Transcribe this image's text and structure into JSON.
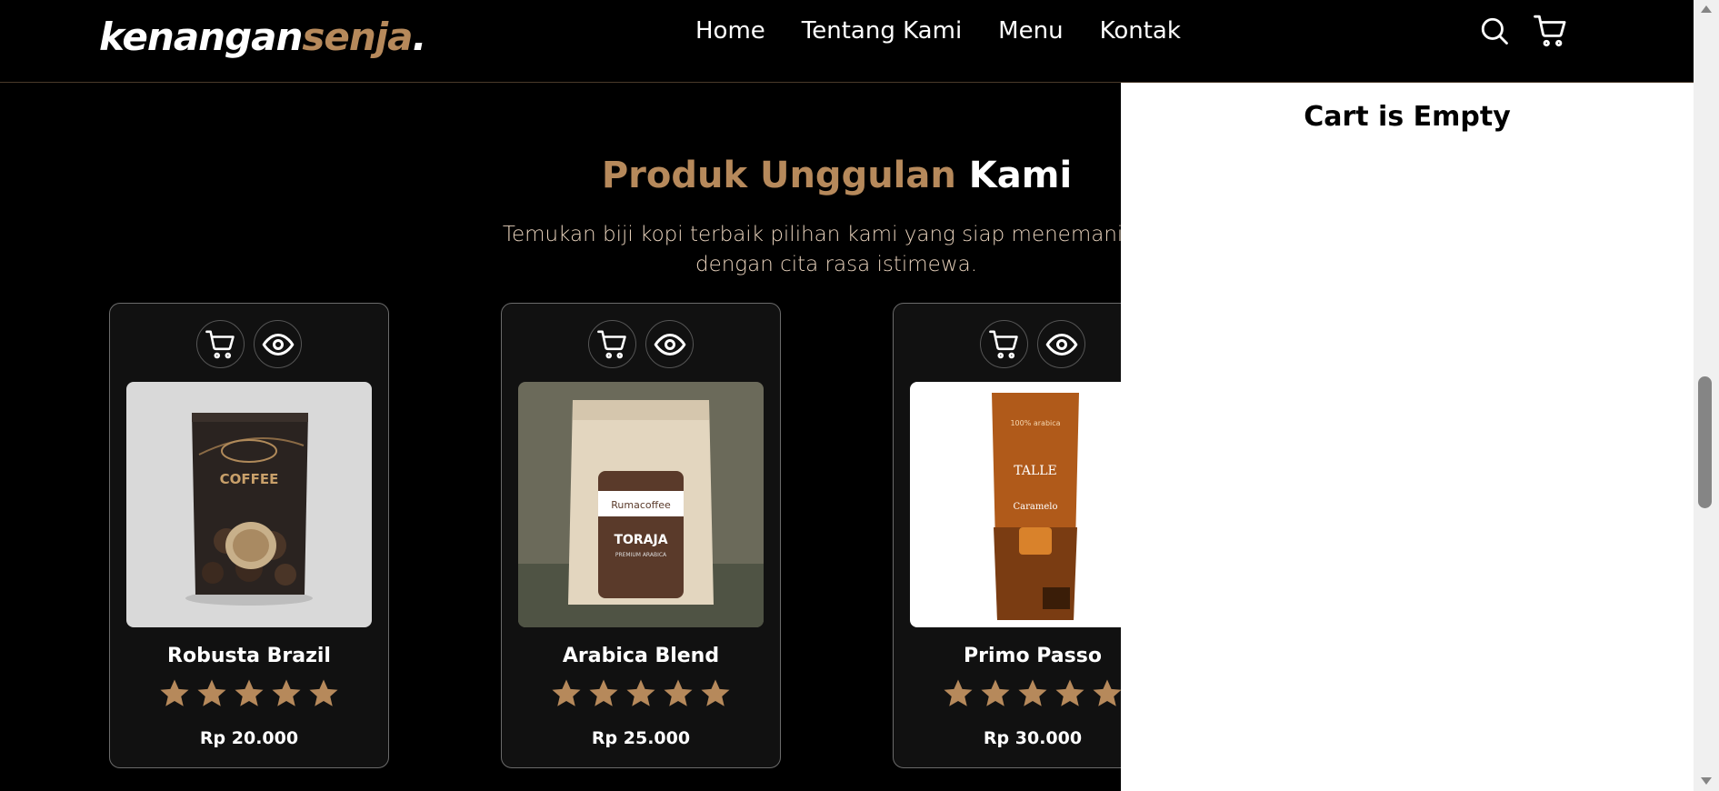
{
  "brand": {
    "part1": "kenangan",
    "part2": "senja",
    "part3": "."
  },
  "nav": {
    "items": [
      "Home",
      "Tentang Kami",
      "Menu",
      "Kontak"
    ]
  },
  "icons": {
    "search": "search-icon",
    "cart": "cart-icon",
    "eye": "eye-icon",
    "star": "star-icon"
  },
  "section": {
    "title_accent": "Produk Unggulan",
    "title_rest": "Kami",
    "desc_line1": "Temukan biji kopi terbaik pilihan kami yang siap menemani hari",
    "desc_line2": "dengan cita rasa istimewa."
  },
  "products": [
    {
      "name": "Robusta Brazil",
      "price": "Rp 20.000",
      "rating": 5
    },
    {
      "name": "Arabica Blend",
      "price": "Rp 25.000",
      "rating": 5
    },
    {
      "name": "Primo Passo",
      "price": "Rp 30.000",
      "rating": 5
    }
  ],
  "cart": {
    "empty_text": "Cart is Empty"
  },
  "colors": {
    "accent": "#b6895b",
    "background": "#000000",
    "card": "#111111",
    "panel": "#ffffff"
  }
}
